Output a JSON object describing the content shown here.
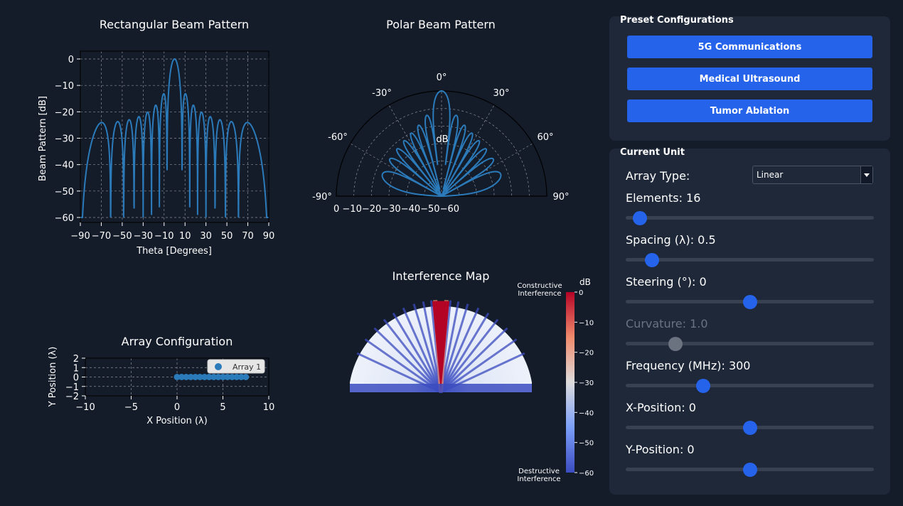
{
  "rect_chart": {
    "title": "Rectangular Beam Pattern",
    "xlabel": "Theta [Degrees]",
    "ylabel": "Beam Pattern [dB]",
    "x_ticks": [
      "−90",
      "−70",
      "−50",
      "−30",
      "−10",
      "10",
      "30",
      "50",
      "70",
      "90"
    ],
    "y_ticks": [
      "0",
      "−10",
      "−20",
      "−30",
      "−40",
      "−50",
      "−60"
    ]
  },
  "polar_chart": {
    "title": "Polar Beam Pattern",
    "angle_labels": [
      "0°",
      "-30°",
      "30°",
      "-60°",
      "60°",
      "-90°",
      "90°"
    ],
    "radial_label": "dB",
    "radial_ticks": "0 −10−20−30−40−50−60"
  },
  "array_chart": {
    "title": "Array Configuration",
    "xlabel": "X Position (λ)",
    "ylabel": "Y Position (λ)",
    "x_ticks": [
      "−10",
      "−5",
      "0",
      "5",
      "10"
    ],
    "y_ticks": [
      "2",
      "1",
      "0",
      "−1",
      "−2"
    ],
    "legend": "Array 1"
  },
  "interference": {
    "title": "Interference Map",
    "top_label_1": "Constructive",
    "top_label_2": "Interference",
    "bottom_label_1": "Destructive",
    "bottom_label_2": "Interference",
    "unit": "dB",
    "colorbar_ticks": [
      "0",
      "−10",
      "−20",
      "−30",
      "−40",
      "−50",
      "−60"
    ]
  },
  "presets": {
    "title": "Preset Configurations",
    "buttons": [
      "5G Communications",
      "Medical Ultrasound",
      "Tumor Ablation"
    ]
  },
  "current_unit": {
    "title": "Current Unit",
    "array_type_label": "Array Type:",
    "array_type_value": "Linear",
    "elements_label": "Elements: 16",
    "spacing_label": "Spacing (λ): 0.5",
    "steering_label": "Steering (°): 0",
    "curvature_label": "Curvature: 1.0",
    "frequency_label": "Frequency (MHz): 300",
    "xpos_label": "X-Position: 0",
    "ypos_label": "Y-Position: 0"
  },
  "colors": {
    "background": "#141b29",
    "panel": "#1e2839",
    "accent": "#2563eb",
    "line": "#2b7bbb"
  },
  "chart_data": [
    {
      "type": "line",
      "title": "Rectangular Beam Pattern",
      "xlabel": "Theta [Degrees]",
      "ylabel": "Beam Pattern [dB]",
      "xlim": [
        -90,
        90
      ],
      "ylim": [
        -60,
        0
      ],
      "series": [
        {
          "elements": 16,
          "spacing_lambda": 0.5,
          "steering_deg": 0
        }
      ]
    },
    {
      "type": "scatter",
      "title": "Array Configuration",
      "xlabel": "X Position (λ)",
      "ylabel": "Y Position (λ)",
      "xlim": [
        -10,
        10
      ],
      "ylim": [
        -2,
        2
      ],
      "series": [
        {
          "name": "Array 1",
          "x": [
            0,
            0.5,
            1,
            1.5,
            2,
            2.5,
            3,
            3.5,
            4,
            4.5,
            5,
            5.5,
            6,
            6.5,
            7,
            7.5
          ],
          "y": [
            0,
            0,
            0,
            0,
            0,
            0,
            0,
            0,
            0,
            0,
            0,
            0,
            0,
            0,
            0,
            0
          ]
        }
      ]
    }
  ]
}
